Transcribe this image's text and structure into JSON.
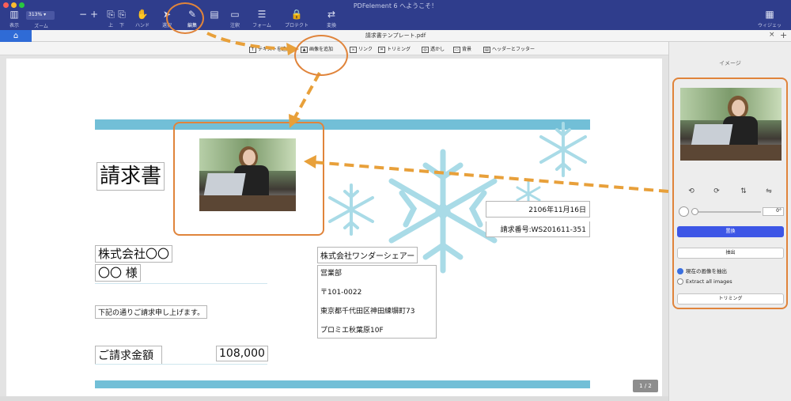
{
  "window": {
    "title": "PDFelement 6 へようこそ！",
    "doc_tab": "請求書テンプレート.pdf",
    "home_icon": "home-icon"
  },
  "toolbar": {
    "zoom_value": "313%",
    "items": [
      {
        "label": "表示",
        "icon": "view-icon",
        "glyph": "▥"
      },
      {
        "label": "ズーム",
        "icon": "zoom-icon",
        "glyph": ""
      },
      {
        "label": "",
        "icon": "zoom-out-icon",
        "glyph": "−"
      },
      {
        "label": "",
        "icon": "zoom-in-icon",
        "glyph": "+"
      },
      {
        "label": "上",
        "icon": "page-up-icon",
        "glyph": "⎘"
      },
      {
        "label": "下",
        "icon": "page-down-icon",
        "glyph": "⎘"
      },
      {
        "label": "ハンド",
        "icon": "hand-icon",
        "glyph": "✋"
      },
      {
        "label": "選択",
        "icon": "select-icon",
        "glyph": "➤"
      },
      {
        "label": "編集",
        "icon": "edit-icon",
        "glyph": "✎"
      },
      {
        "label": "",
        "icon": "page-icon",
        "glyph": "▤"
      },
      {
        "label": "注釈",
        "icon": "comment-icon",
        "glyph": "▭"
      },
      {
        "label": "フォーム",
        "icon": "form-icon",
        "glyph": "☰"
      },
      {
        "label": "プロテクト",
        "icon": "lock-icon",
        "glyph": "🔒"
      },
      {
        "label": "変換",
        "icon": "convert-icon",
        "glyph": "⇄"
      },
      {
        "label": "ウィジェット",
        "icon": "widget-icon",
        "glyph": "▦"
      }
    ]
  },
  "subtoolbar": {
    "items": [
      {
        "label": "テキストを追加",
        "icon": "add-text-icon",
        "glyph": "T"
      },
      {
        "label": "画像を追加",
        "icon": "add-image-icon",
        "glyph": "▲"
      },
      {
        "label": "リンク",
        "icon": "link-icon",
        "glyph": "∞"
      },
      {
        "label": "トリミング",
        "icon": "crop-icon",
        "glyph": "⌗"
      },
      {
        "label": "透かし",
        "icon": "watermark-icon",
        "glyph": "◎"
      },
      {
        "label": "背景",
        "icon": "background-icon",
        "glyph": "▭"
      },
      {
        "label": "ヘッダーとフッター",
        "icon": "header-footer-icon",
        "glyph": "▤"
      }
    ]
  },
  "document": {
    "title": "請求書",
    "client_company": "株式会社〇〇",
    "client_name": "〇〇 様",
    "request_text": "下記の通りご請求申し上げます。",
    "amount_label": "ご請求金額",
    "amount_value": "108,000",
    "date": "2106年11月16日",
    "invoice_number": "請求番号:WS201611-351",
    "issuer_company": "株式会社ワンダーシェアー",
    "issuer_lines": [
      "営業部",
      "〒101-0022",
      "東京都千代田区神田練塀町73",
      "プロミエ秋葉原10F"
    ],
    "page_indicator": "1 / 2"
  },
  "right_panel": {
    "title": "イメージ",
    "tool_icons": [
      "rotate-left-icon",
      "rotate-right-icon",
      "flip-vertical-icon",
      "flip-horizontal-icon"
    ],
    "tool_glyphs": [
      "⟲",
      "⟳",
      "⇅",
      "⇋"
    ],
    "rotation_value": "0°",
    "replace_label": "置換",
    "extract_label": "抽出",
    "radio_current": "現在の画像を抽出",
    "radio_all": "Extract all images",
    "crop_label": "トリミング"
  },
  "colors": {
    "accent": "#2f3d8c",
    "primary_button": "#3d56e6",
    "band": "#72bfd7",
    "annotation": "#e0843b"
  }
}
